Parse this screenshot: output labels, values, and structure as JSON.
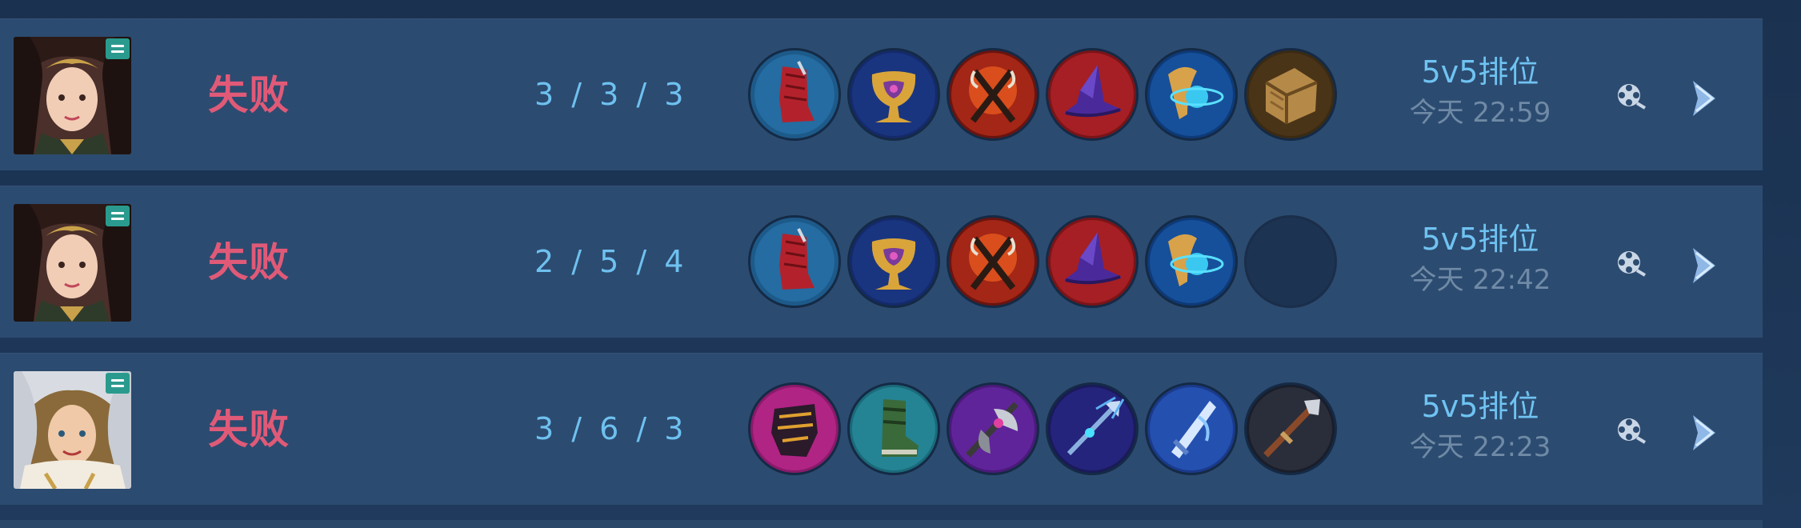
{
  "matches": [
    {
      "hero_icon": "hero-portrait-dark-hair",
      "result": "失败",
      "kda": "3 / 3 / 3",
      "items": [
        "red-boots-icon",
        "gold-chalice-icon",
        "red-fire-blades-icon",
        "purple-hat-icon",
        "blue-orb-wing-icon",
        "wooden-chest-icon"
      ],
      "mode": "5v5排位",
      "time": "今天 22:59"
    },
    {
      "hero_icon": "hero-portrait-dark-hair",
      "result": "失败",
      "kda": "2 / 5 / 4",
      "items": [
        "red-boots-icon",
        "gold-chalice-icon",
        "red-fire-blades-icon",
        "purple-hat-icon",
        "blue-orb-wing-icon",
        "empty-slot"
      ],
      "mode": "5v5排位",
      "time": "今天 22:42"
    },
    {
      "hero_icon": "hero-portrait-silver-hair",
      "result": "失败",
      "kda": "3 / 6 / 3",
      "items": [
        "dark-armor-icon",
        "green-boots-icon",
        "purple-axe-icon",
        "blue-trident-icon",
        "blue-sword-icon",
        "dark-spear-icon"
      ],
      "mode": "5v5排位",
      "time": "今天 22:23"
    }
  ],
  "colors": {
    "row_background": "#2c4b70",
    "result_defeat": "#e05a78",
    "kda": "#6ec1f0",
    "mode": "#6fc3f2",
    "time": "#6f8aa6"
  },
  "icons": {
    "replay": "film-reel-icon",
    "details": "chevron-right-icon"
  }
}
